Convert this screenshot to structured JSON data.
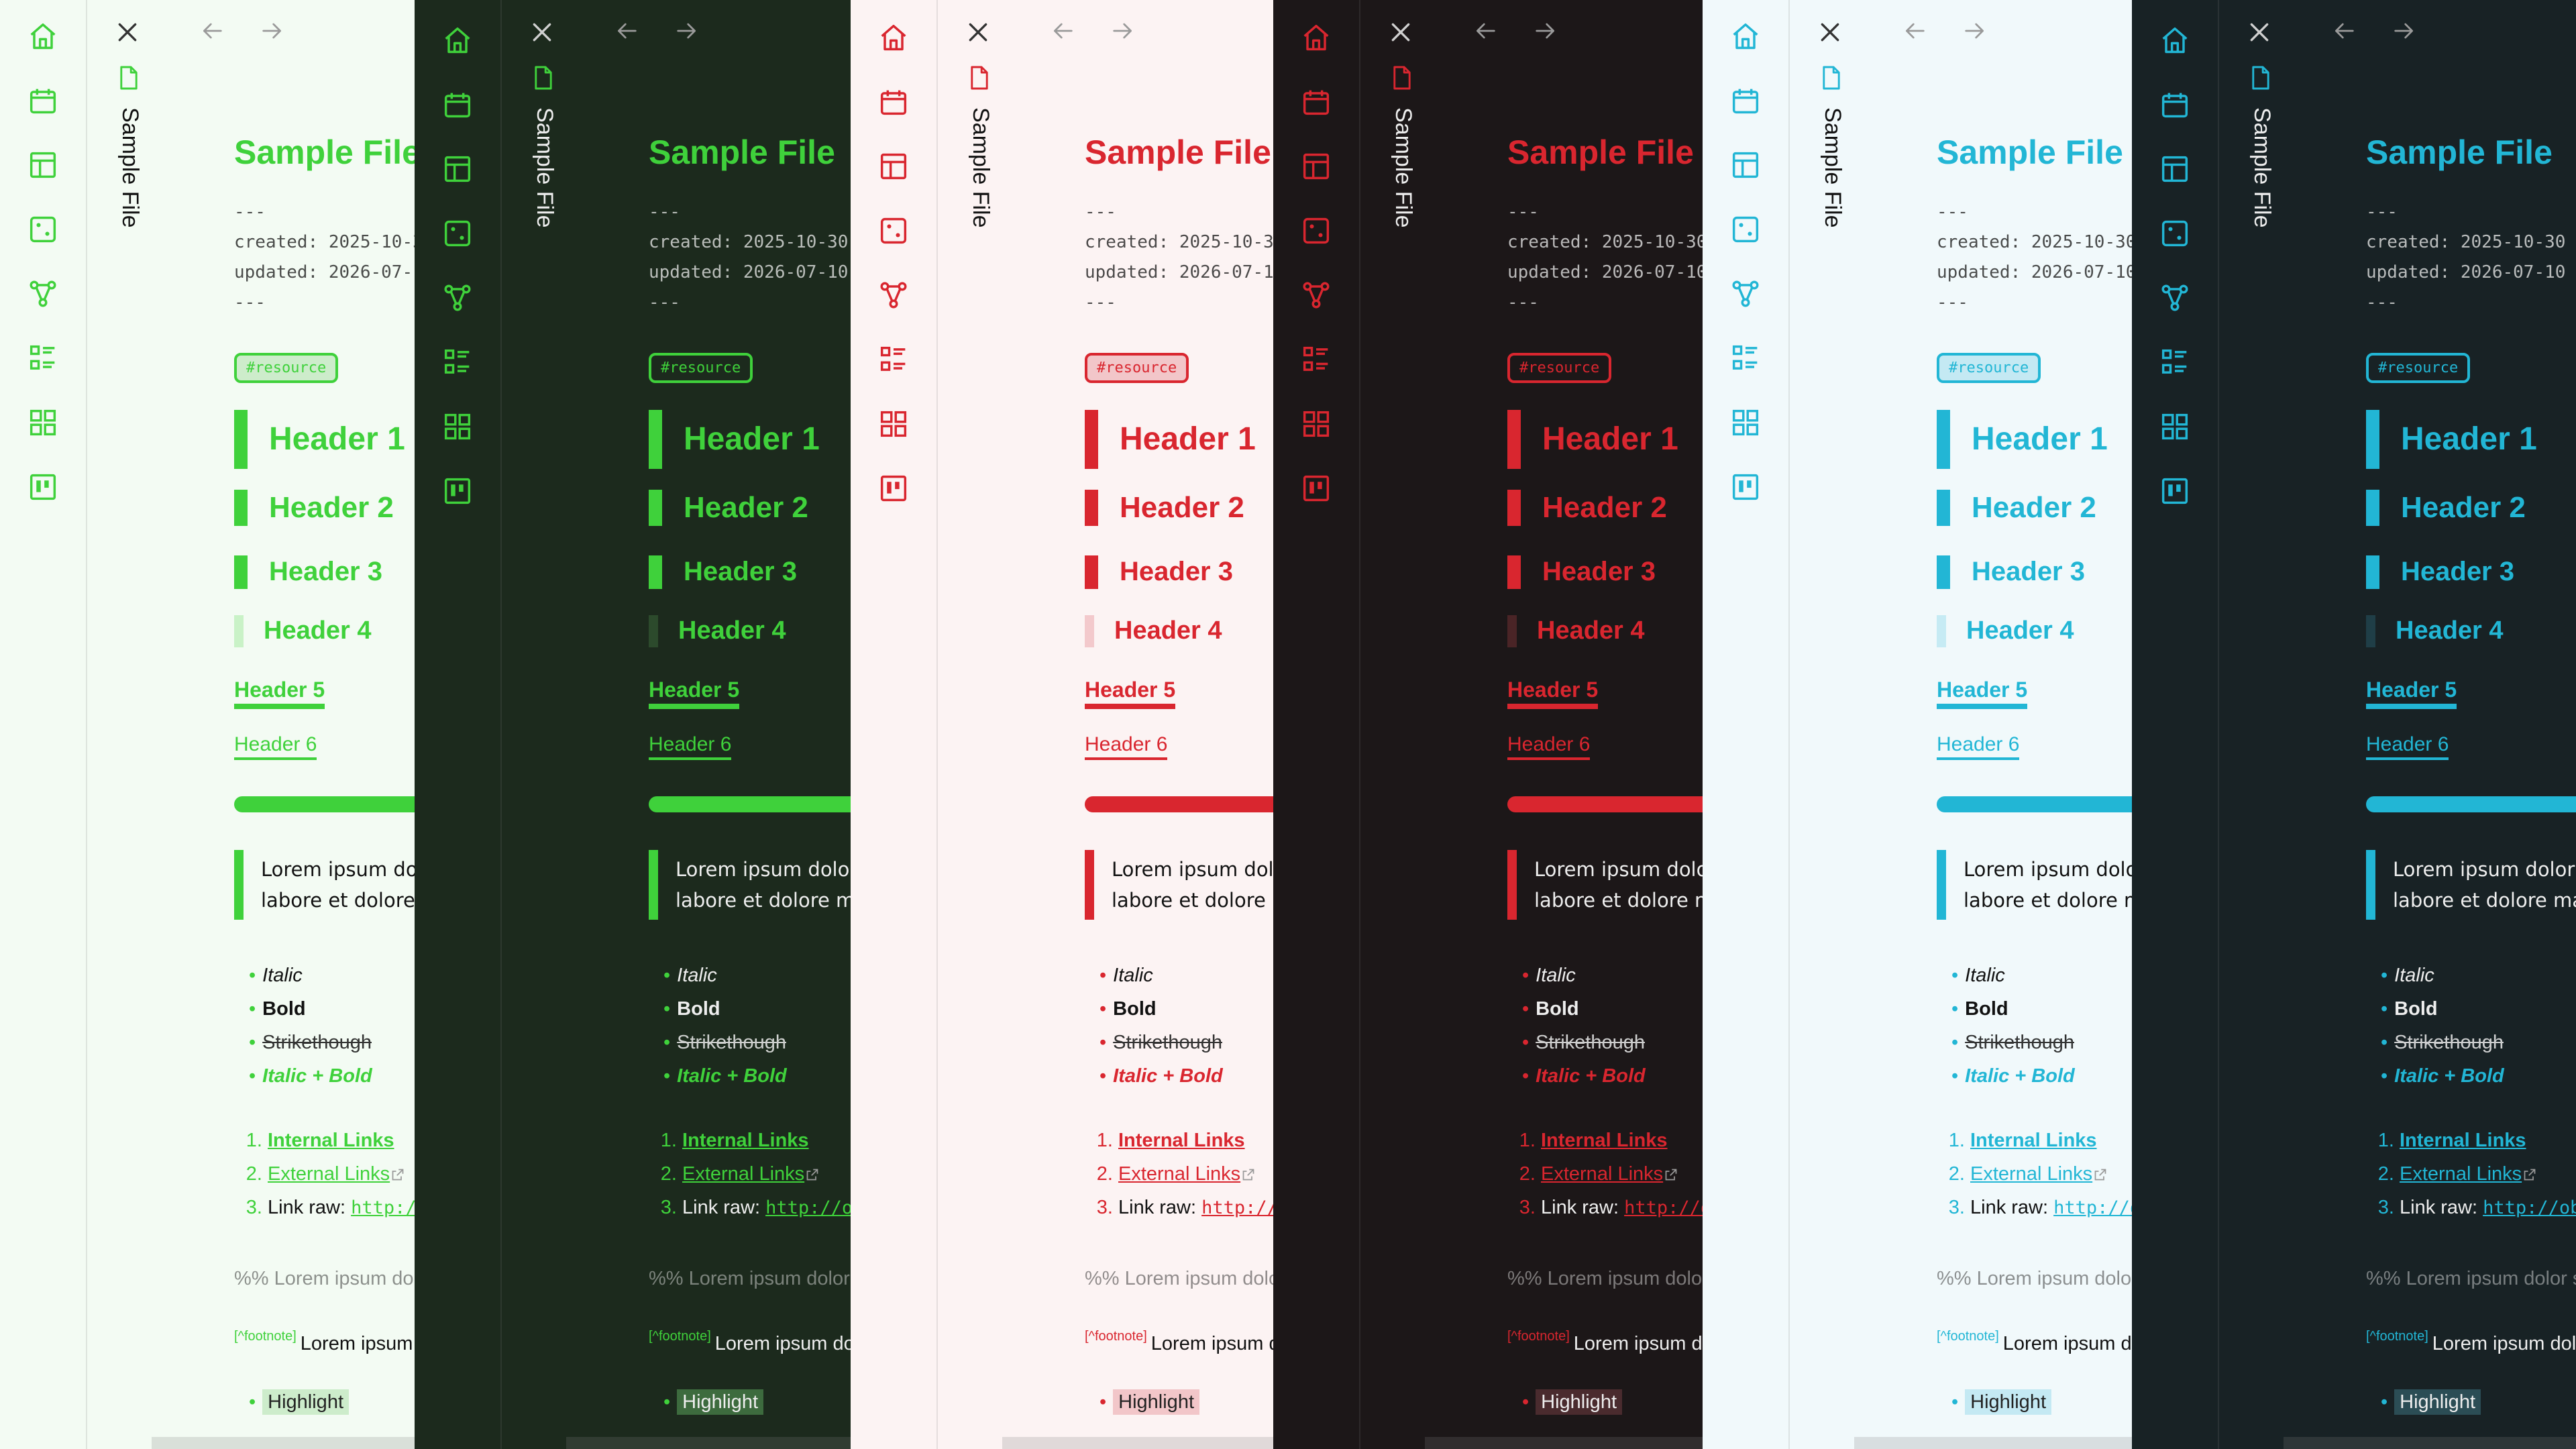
{
  "panels": [
    {
      "theme": "green-light",
      "mode": "light",
      "accent": "#3fd13b",
      "faint": "#c9f2c7",
      "bg": "#f3fbf3",
      "side": "#f3fbf3",
      "hlbg": "#cdeccb"
    },
    {
      "theme": "green-dark",
      "mode": "dark",
      "accent": "#3fd13b",
      "faint": "#2c4a2c",
      "bg": "#1c2a1d",
      "side": "#1c2a1d",
      "hlbg": "#3d6b3e"
    },
    {
      "theme": "red-light",
      "mode": "light",
      "accent": "#d9262f",
      "faint": "#f3c9cc",
      "bg": "#fcf3f3",
      "side": "#fcf3f3",
      "hlbg": "#f2c6c9"
    },
    {
      "theme": "red-dark",
      "mode": "dark",
      "accent": "#d9262f",
      "faint": "#4a2426",
      "bg": "#1c1718",
      "side": "#1c1718",
      "hlbg": "#4a2b2e"
    },
    {
      "theme": "cyan-light",
      "mode": "light",
      "accent": "#22b6d5",
      "faint": "#c6ebf4",
      "bg": "#f1f9fb",
      "side": "#f1f9fb",
      "hlbg": "#c4e9f3"
    },
    {
      "theme": "cyan-dark",
      "mode": "dark",
      "accent": "#22b6d5",
      "faint": "#1f3e47",
      "bg": "#182225",
      "side": "#182225",
      "hlbg": "#2b4d55"
    }
  ],
  "ribbon_icons": [
    "home-icon",
    "calendar-icon",
    "layout-icon",
    "dice-icon",
    "graph-icon",
    "list-icon",
    "grid-icon",
    "kanban-icon"
  ],
  "tab": {
    "title": "Sample File",
    "close_icon": "close-icon",
    "file_icon": "file-icon"
  },
  "nav": {
    "back_icon": "arrow-left-icon",
    "forward_icon": "arrow-right-icon"
  },
  "doc": {
    "title": "Sample File",
    "frontmatter_open": "---",
    "created": "created: 2025-10-30",
    "updated": "updated: 2026-07-10",
    "frontmatter_close": "---",
    "tag": "#resource",
    "h1": "Header 1",
    "h2": "Header 2",
    "h3": "Header 3",
    "h4": "Header 4",
    "h5": "Header 5",
    "h6": "Header 6",
    "quote_line1": "Lorem ipsum dolor sit amet, consectetur adipiscing elit, sed do eiusmod tempor incididunt ut",
    "quote_line2": "labore et dolore magna aliqua.",
    "list": {
      "italic": "Italic",
      "bold": "Bold",
      "strike": "Strikethough",
      "italic_bold": "Italic + Bold"
    },
    "links": {
      "internal": "Internal Links",
      "external": "External Links",
      "raw_label": "Link raw: ",
      "raw_url": "http://obsidian.md"
    },
    "comment": "%% Lorem ipsum dolor sit amet %%",
    "footnote_ref": "[^footnote]",
    "footnote_text": "Lorem ipsum dolor sit amet",
    "highlight": "Highlight"
  }
}
